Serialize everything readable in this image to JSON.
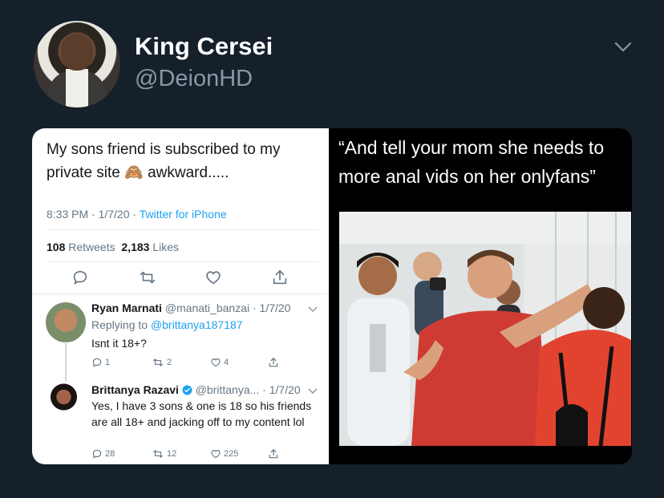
{
  "author": {
    "display_name": "King Cersei",
    "handle": "@DeionHD"
  },
  "embedded_tweet": {
    "text": "My sons friend is subscribed to my private site 🙈 awkward.....",
    "time": "8:33 PM · 1/7/20 ·",
    "source": "Twitter for iPhone",
    "retweets_count": "108",
    "retweets_label": "Retweets",
    "likes_count": "2,183",
    "likes_label": "Likes"
  },
  "replies": [
    {
      "name": "Ryan Marnati",
      "meta": "@manati_banzai · 1/7/20",
      "replying_prefix": "Replying to",
      "replying_to": "@brittanya187187",
      "text": "Isnt it 18+?",
      "reply_count": "1",
      "retweet_count": "2",
      "like_count": "4"
    },
    {
      "name": "Brittanya Razavi",
      "meta": "@brittanya... · 1/7/20",
      "text": "Yes, I have 3 sons & one is 18 so his friends are all 18+ and jacking off to my content lol",
      "reply_count": "28",
      "retweet_count": "12",
      "like_count": "225"
    }
  ],
  "meme": {
    "caption": "“And tell your mom she needs to more anal vids on her onlyfans”"
  },
  "colors": {
    "background": "#15202b",
    "handle": "#8899a6",
    "link": "#1da1f2",
    "verified": "#1da1f2"
  }
}
